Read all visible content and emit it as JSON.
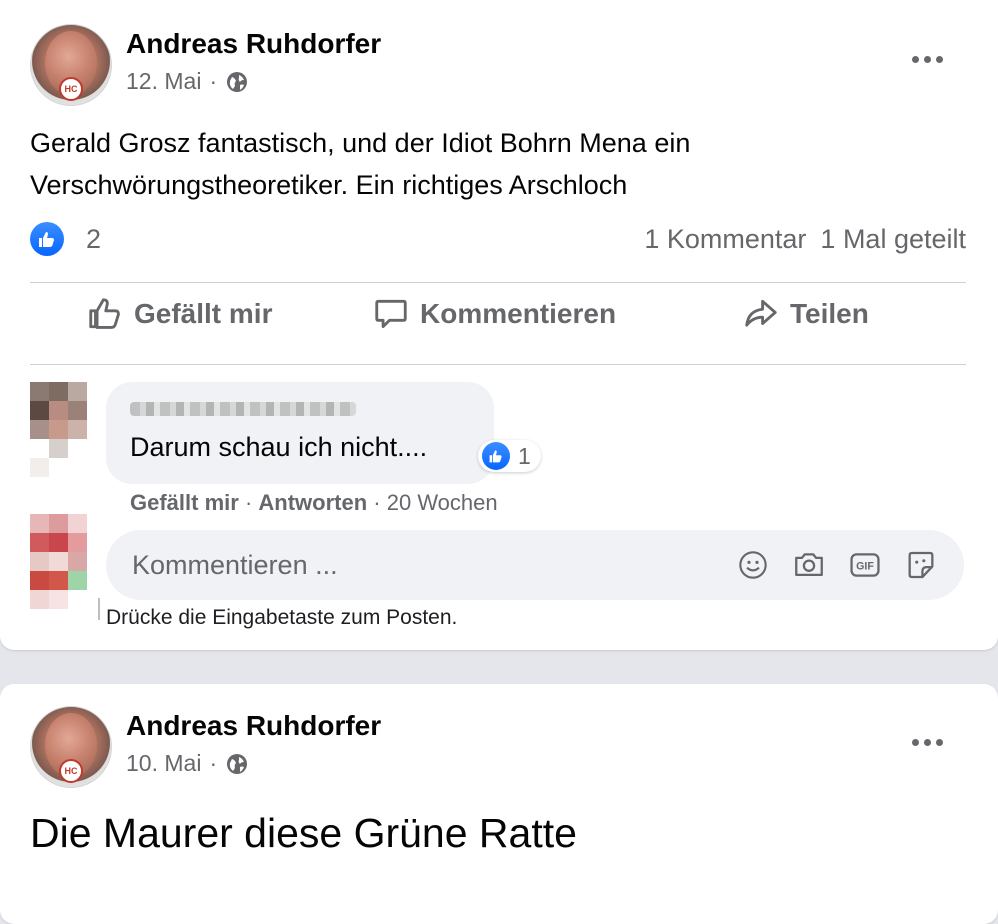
{
  "posts": [
    {
      "author": "Andreas Ruhdorfer",
      "date": "12. Mai",
      "separator": "·",
      "avatar_badge": "HC",
      "text_lines": [
        "Gerald Grosz fantastisch, und der Idiot Bohrn Mena ein",
        "Verschwörungstheoretiker. Ein richtiges Arschloch"
      ],
      "like_count": "2",
      "comments_count": "1 Kommentar",
      "shares": "1 Mal geteilt",
      "actions": {
        "like": "Gefällt mir",
        "comment": "Kommentieren",
        "share": "Teilen"
      },
      "comment": {
        "text": "Darum schau ich nicht....",
        "reaction_count": "1",
        "like": "Gefällt mir",
        "reply": "Antworten",
        "dot": "·",
        "age": "20 Wochen"
      },
      "comment_input": {
        "placeholder": "Kommentieren ...",
        "hint": "Drücke die Eingabetaste zum Posten.",
        "icons": [
          "emoji-icon",
          "camera-icon",
          "gif-icon",
          "sticker-icon"
        ]
      }
    },
    {
      "author": "Andreas Ruhdorfer",
      "date": "10. Mai",
      "separator": "·",
      "avatar_badge": "HC",
      "text": "Die Maurer diese Grüne Ratte"
    }
  ],
  "colors": {
    "accent": "#0866ff",
    "secondary_text": "#65676b",
    "bubble": "#f0f2f5",
    "divider": "#ced0d4"
  }
}
